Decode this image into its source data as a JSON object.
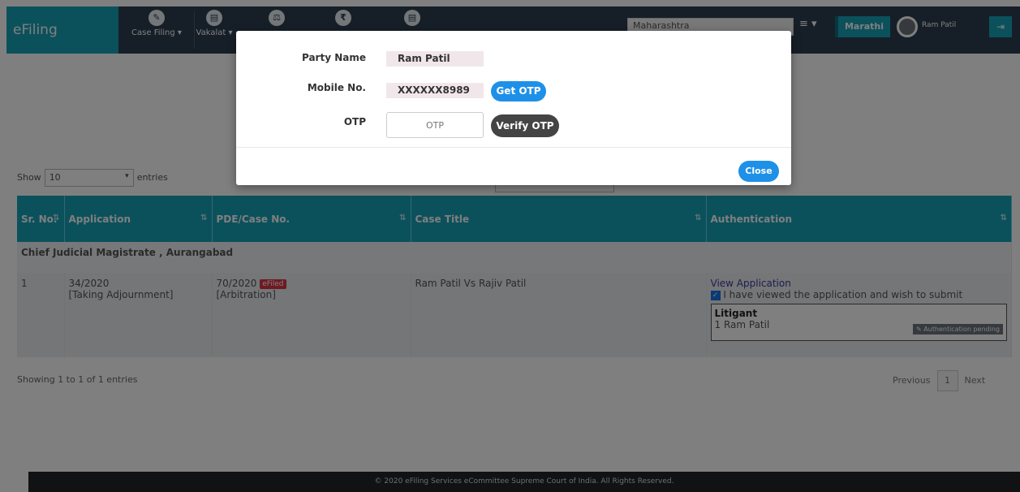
{
  "header": {
    "brand": "eFiling Services",
    "nav": [
      {
        "label": "Case Filing ▾",
        "icon": "✎",
        "icon_name": "pencil-icon"
      },
      {
        "label": "Vakalat ▾",
        "icon": "▤",
        "icon_name": "document-icon"
      },
      {
        "label": "",
        "icon": "⚖",
        "icon_name": "scale-icon"
      },
      {
        "label": "",
        "icon": "₹",
        "icon_name": "rupee-icon"
      },
      {
        "label": "",
        "icon": "▤",
        "icon_name": "file-icon"
      }
    ],
    "state": "Maharashtra",
    "menu_icon": "≡ ▾",
    "language": "Marathi",
    "user": "Ram Patil",
    "logout_icon": "⇥"
  },
  "listing": {
    "show": "Show",
    "entries_value": "10",
    "entries": "entries",
    "columns": [
      "Sr. No.",
      "Application",
      "PDE/Case No.",
      "Case Title",
      "Authentication"
    ],
    "court": "Chief Judicial Magistrate , Aurangabad",
    "row": {
      "sr": "1",
      "application": "34/2020",
      "application_type": "[Taking Adjournment]",
      "case_no": "70/2020",
      "efiled": "eFiled",
      "case_type": "[Arbitration]",
      "title": "Ram Patil Vs Rajiv Patil",
      "view_link": "View Application",
      "confirm_text": "I have viewed the application and wish to submit",
      "litigant_heading": "Litigant",
      "litigant": "1 Ram Patil",
      "auth_status": "Authentication pending"
    },
    "showing": "Showing 1 to 1 of 1 entries",
    "previous": "Previous",
    "page": "1",
    "next": "Next"
  },
  "footer": "© 2020 eFiling Services eCommittee Supreme Court of India. All Rights Reserved.",
  "modal": {
    "party_name_label": "Party Name",
    "party_name": "Ram Patil",
    "mobile_label": "Mobile No.",
    "mobile": "XXXXXX8989",
    "get_otp": "Get OTP",
    "otp_label": "OTP",
    "otp_placeholder": "OTP",
    "verify_otp": "Verify OTP",
    "close": "Close"
  },
  "colors": {
    "teal": "#17a2b8",
    "blue_button": "#1e90e8",
    "dark_button": "#444444"
  }
}
